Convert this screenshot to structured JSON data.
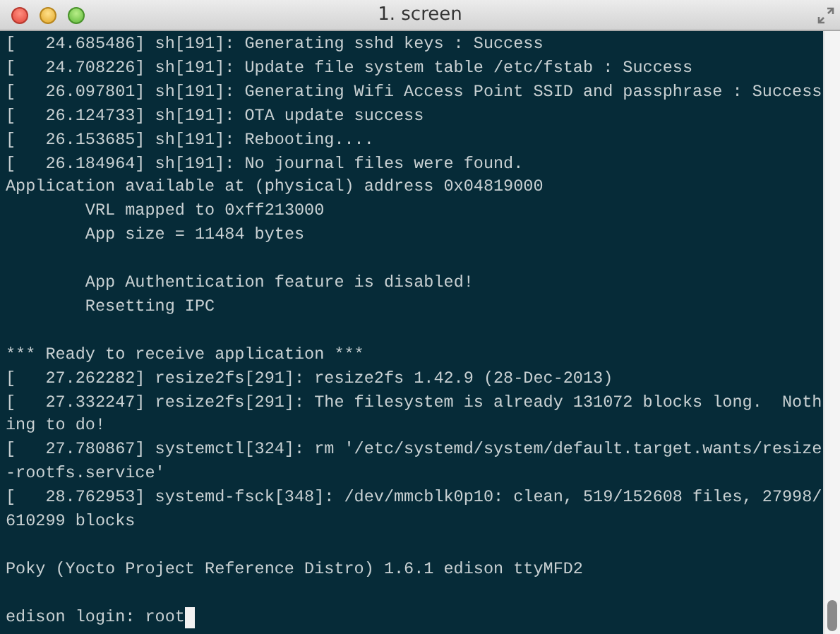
{
  "window": {
    "title": "1. screen"
  },
  "terminal": {
    "blocks": [
      [
        "[   24.685486] sh[191]: Generating sshd keys : Success",
        "[   24.708226] sh[191]: Update file system table /etc/fstab : Success",
        "[   26.097801] sh[191]: Generating Wifi Access Point SSID and passphrase : Success",
        "[   26.124733] sh[191]: OTA update success",
        "[   26.153685] sh[191]: Rebooting....",
        "[   26.184964] sh[191]: No journal files were found.",
        "Application available at (physical) address 0x04819000",
        "        VRL mapped to 0xff213000",
        "        App size = 11484 bytes"
      ],
      [
        "        App Authentication feature is disabled!",
        "        Resetting IPC"
      ],
      [
        "*** Ready to receive application ***",
        "[   27.262282] resize2fs[291]: resize2fs 1.42.9 (28-Dec-2013)",
        "[   27.332247] resize2fs[291]: The filesystem is already 131072 blocks long.  Nothing to do!",
        "[   27.780867] systemctl[324]: rm '/etc/systemd/system/default.target.wants/resize-rootfs.service'",
        "[   28.762953] systemd-fsck[348]: /dev/mmcblk0p10: clean, 519/152608 files, 27998/610299 blocks"
      ],
      [
        "Poky (Yocto Project Reference Distro) 1.6.1 edison ttyMFD2"
      ]
    ],
    "prompt": "edison login: root"
  }
}
